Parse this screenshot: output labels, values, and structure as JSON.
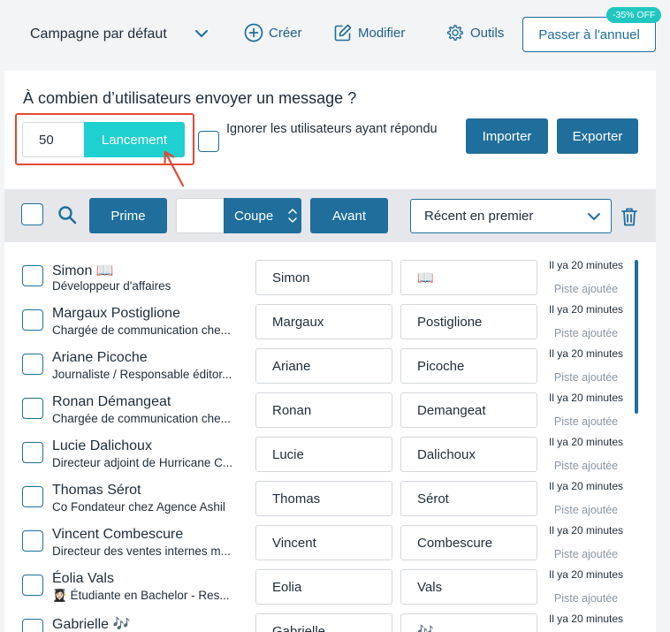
{
  "header": {
    "campaign_label": "Campagne par défaut",
    "create_label": "Créer",
    "edit_label": "Modifier",
    "tools_label": "Outils",
    "upgrade_label": "Passer à l'annuel",
    "discount_badge": "-35% OFF"
  },
  "send": {
    "question": "À combien d’utilisateurs envoyer un message ?",
    "count_value": "50",
    "launch_label": "Lancement",
    "ignore_label": "Ignorer les utilisateurs ayant répondu",
    "import_label": "Importer",
    "export_label": "Exporter"
  },
  "toolbar": {
    "prime_label": "Prime",
    "cut_label": "Coupe",
    "forward_label": "Avant",
    "sort_value": "Récent en premier"
  },
  "list": {
    "rows": [
      {
        "name": "Simon 📖",
        "title": "Développeur d'affaires",
        "first": "Simon",
        "last": "📖",
        "time": "Il ya 20 minutes",
        "status": "Piste ajoutée"
      },
      {
        "name": "Margaux Postiglione",
        "title": "Chargée de communication che...",
        "first": "Margaux",
        "last": "Postiglione",
        "time": "Il ya 20 minutes",
        "status": "Piste ajoutée"
      },
      {
        "name": "Ariane Picoche",
        "title": "Journaliste / Responsable éditor...",
        "first": "Ariane",
        "last": "Picoche",
        "time": "Il ya 20 minutes",
        "status": "Piste ajoutée"
      },
      {
        "name": "Ronan Démangeat",
        "title": "Chargée de communication che...",
        "first": "Ronan",
        "last": "Demangeat",
        "time": "Il ya 20 minutes",
        "status": "Piste ajoutée"
      },
      {
        "name": "Lucie Dalichoux",
        "title": "Directeur adjoint de Hurricane C...",
        "first": "Lucie",
        "last": "Dalichoux",
        "time": "Il ya 20 minutes",
        "status": "Piste ajoutée"
      },
      {
        "name": "Thomas Sérot",
        "title": "Co Fondateur chez Agence Ashil",
        "first": "Thomas",
        "last": "Sérot",
        "time": "Il ya 20 minutes",
        "status": "Piste ajoutée"
      },
      {
        "name": "Vincent Combescure",
        "title": "Directeur des ventes internes m...",
        "first": "Vincent",
        "last": "Combescure",
        "time": "Il ya 20 minutes",
        "status": "Piste ajoutée"
      },
      {
        "name": "Éolia Vals",
        "title": "👩🏻‍🎓 Étudiante en Bachelor - Res...",
        "first": "Eolia",
        "last": "Vals",
        "time": "Il ya 20 minutes",
        "status": "Piste ajoutée"
      },
      {
        "name": "Gabrielle 🎶",
        "title": "",
        "first": "Gabrielle",
        "last": "🎶",
        "time": "Il ya 20 minutes",
        "status": ""
      }
    ]
  },
  "colors": {
    "primary": "#1f6e9c",
    "accent": "#1ed0d0",
    "highlight": "#e14a35",
    "badge": "#20c7c0"
  }
}
